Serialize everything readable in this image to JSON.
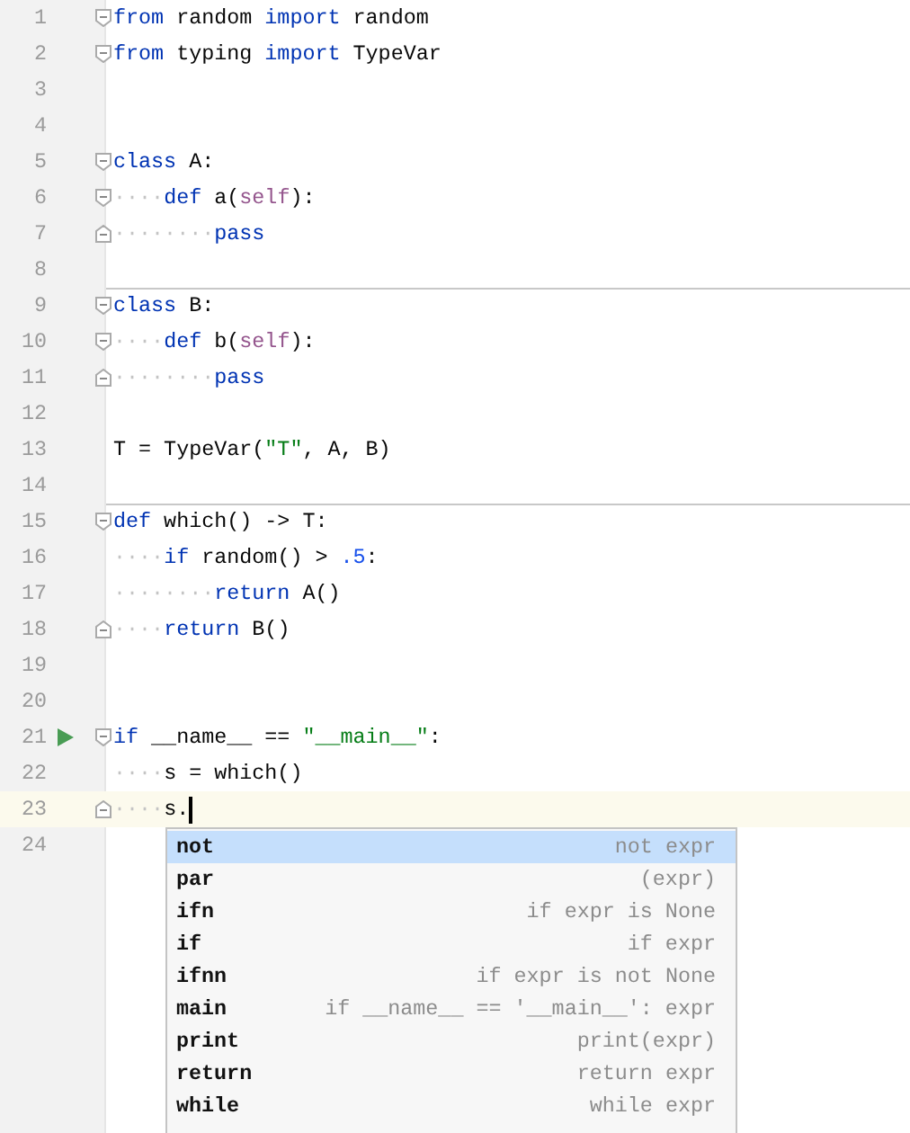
{
  "editor": {
    "lines": [
      {
        "number": "1",
        "fold": {
          "kind": "start"
        },
        "separator": false,
        "current": false,
        "tokens": [
          {
            "kind": "kw",
            "text": "from"
          },
          {
            "kind": "plain",
            "text": " random "
          },
          {
            "kind": "kw",
            "text": "import"
          },
          {
            "kind": "plain",
            "text": " random"
          }
        ]
      },
      {
        "number": "2",
        "fold": {
          "kind": "start"
        },
        "separator": false,
        "current": false,
        "tokens": [
          {
            "kind": "kw",
            "text": "from"
          },
          {
            "kind": "plain",
            "text": " typing "
          },
          {
            "kind": "kw",
            "text": "import"
          },
          {
            "kind": "plain",
            "text": " TypeVar"
          }
        ]
      },
      {
        "number": "3",
        "separator": false,
        "current": false
      },
      {
        "number": "4",
        "separator": false,
        "current": false
      },
      {
        "number": "5",
        "fold": {
          "kind": "start"
        },
        "separator": false,
        "current": false,
        "tokens": [
          {
            "kind": "kw",
            "text": "class"
          },
          {
            "kind": "plain",
            "text": " A:"
          }
        ]
      },
      {
        "number": "6",
        "fold": {
          "kind": "start"
        },
        "separator": false,
        "current": false,
        "tokens": [
          {
            "kind": "indent",
            "text": "····"
          },
          {
            "kind": "kw",
            "text": "def"
          },
          {
            "kind": "plain",
            "text": " a("
          },
          {
            "kind": "self",
            "text": "self"
          },
          {
            "kind": "plain",
            "text": "):"
          }
        ]
      },
      {
        "number": "7",
        "fold": {
          "kind": "end"
        },
        "separator": false,
        "current": false,
        "tokens": [
          {
            "kind": "indent",
            "text": "········"
          },
          {
            "kind": "kw",
            "text": "pass"
          }
        ]
      },
      {
        "number": "8",
        "separator": false,
        "current": false
      },
      {
        "number": "9",
        "fold": {
          "kind": "start"
        },
        "separator": true,
        "current": false,
        "tokens": [
          {
            "kind": "kw",
            "text": "class"
          },
          {
            "kind": "plain",
            "text": " B:"
          }
        ]
      },
      {
        "number": "10",
        "fold": {
          "kind": "start"
        },
        "separator": false,
        "current": false,
        "tokens": [
          {
            "kind": "indent",
            "text": "····"
          },
          {
            "kind": "kw",
            "text": "def"
          },
          {
            "kind": "plain",
            "text": " b("
          },
          {
            "kind": "self",
            "text": "self"
          },
          {
            "kind": "plain",
            "text": "):"
          }
        ]
      },
      {
        "number": "11",
        "fold": {
          "kind": "end"
        },
        "separator": false,
        "current": false,
        "tokens": [
          {
            "kind": "indent",
            "text": "········"
          },
          {
            "kind": "kw",
            "text": "pass"
          }
        ]
      },
      {
        "number": "12",
        "separator": false,
        "current": false
      },
      {
        "number": "13",
        "separator": false,
        "current": false,
        "tokens": [
          {
            "kind": "plain",
            "text": "T = TypeVar("
          },
          {
            "kind": "str",
            "text": "\"T\""
          },
          {
            "kind": "plain",
            "text": ", A, B)"
          }
        ]
      },
      {
        "number": "14",
        "separator": false,
        "current": false
      },
      {
        "number": "15",
        "fold": {
          "kind": "start"
        },
        "separator": true,
        "current": false,
        "tokens": [
          {
            "kind": "kw",
            "text": "def"
          },
          {
            "kind": "plain",
            "text": " which() -> T:"
          }
        ]
      },
      {
        "number": "16",
        "separator": false,
        "current": false,
        "tokens": [
          {
            "kind": "indent",
            "text": "····"
          },
          {
            "kind": "kw",
            "text": "if"
          },
          {
            "kind": "plain",
            "text": " random() > "
          },
          {
            "kind": "num",
            "text": ".5"
          },
          {
            "kind": "plain",
            "text": ":"
          }
        ]
      },
      {
        "number": "17",
        "separator": false,
        "current": false,
        "tokens": [
          {
            "kind": "indent",
            "text": "········"
          },
          {
            "kind": "kw",
            "text": "return"
          },
          {
            "kind": "plain",
            "text": " A()"
          }
        ]
      },
      {
        "number": "18",
        "fold": {
          "kind": "end"
        },
        "separator": false,
        "current": false,
        "tokens": [
          {
            "kind": "indent",
            "text": "····"
          },
          {
            "kind": "kw",
            "text": "return"
          },
          {
            "kind": "plain",
            "text": " B()"
          }
        ]
      },
      {
        "number": "19",
        "separator": false,
        "current": false
      },
      {
        "number": "20",
        "separator": false,
        "current": false
      },
      {
        "number": "21",
        "fold": {
          "kind": "start"
        },
        "marker": {
          "kind": "run"
        },
        "separator": false,
        "current": false,
        "tokens": [
          {
            "kind": "kw",
            "text": "if"
          },
          {
            "kind": "plain",
            "text": " __name__ == "
          },
          {
            "kind": "str",
            "text": "\"__main__\""
          },
          {
            "kind": "plain",
            "text": ":"
          }
        ]
      },
      {
        "number": "22",
        "separator": false,
        "current": false,
        "tokens": [
          {
            "kind": "indent",
            "text": "····"
          },
          {
            "kind": "plain",
            "text": "s = which()"
          }
        ]
      },
      {
        "number": "23",
        "fold": {
          "kind": "end"
        },
        "separator": false,
        "current": true,
        "tokens": [
          {
            "kind": "indent",
            "text": "····"
          },
          {
            "kind": "plain",
            "text": "s."
          }
        ]
      },
      {
        "number": "24",
        "separator": false,
        "current": false
      }
    ]
  },
  "completion": {
    "items": [
      {
        "name": "not",
        "hint": "not expr",
        "selected": true
      },
      {
        "name": "par",
        "hint": "(expr)",
        "selected": false
      },
      {
        "name": "ifn",
        "hint": "if expr is None",
        "selected": false
      },
      {
        "name": "if",
        "hint": "if expr",
        "selected": false
      },
      {
        "name": "ifnn",
        "hint": "if expr is not None",
        "selected": false
      },
      {
        "name": "main",
        "hint": "if __name__ == '__main__': expr",
        "selected": false
      },
      {
        "name": "print",
        "hint": "print(expr)",
        "selected": false
      },
      {
        "name": "return",
        "hint": "return expr",
        "selected": false
      },
      {
        "name": "while",
        "hint": "while expr",
        "selected": false
      }
    ]
  }
}
